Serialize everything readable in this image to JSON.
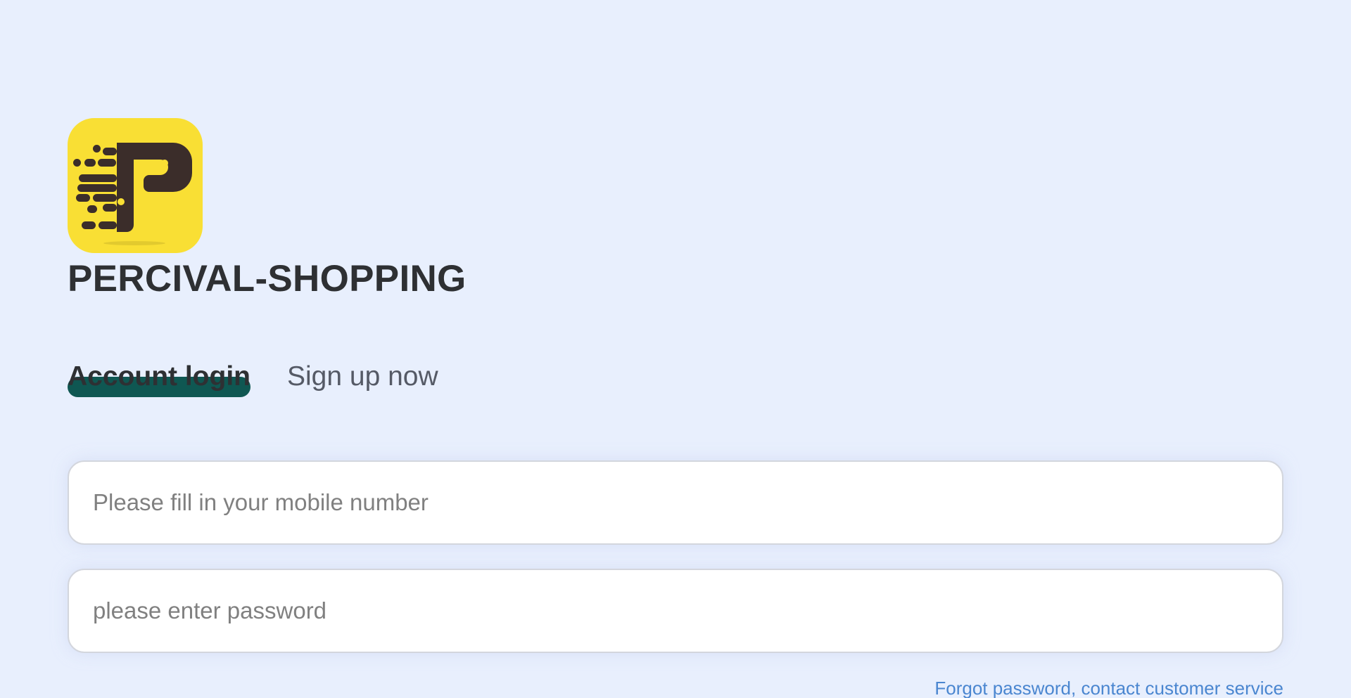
{
  "brand": {
    "logo_icon": "percival-p-logo-icon",
    "logo_bg_color": "#f9df34",
    "logo_fg_color": "#3b2d2a",
    "name": "PERCIVAL-SHOPPING"
  },
  "tabs": [
    {
      "label": "Account login",
      "active": true
    },
    {
      "label": "Sign up now",
      "active": false
    }
  ],
  "colors": {
    "background": "#e8effd",
    "active_tab_indicator": "#0f5752",
    "link": "#4a86d0"
  },
  "form": {
    "mobile": {
      "placeholder": "Please fill in your mobile number",
      "value": ""
    },
    "password": {
      "placeholder": "please enter password",
      "value": ""
    }
  },
  "links": {
    "forgot_password": "Forgot password, contact customer service"
  }
}
